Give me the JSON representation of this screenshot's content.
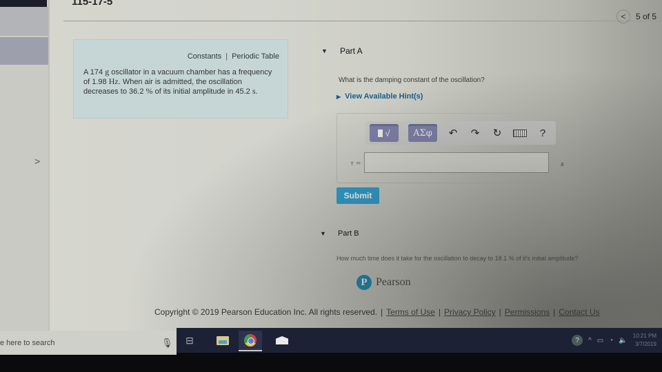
{
  "header": {
    "title": "115-17-5",
    "pager": {
      "prev_icon": "chevron-left-icon",
      "count": "5 of 5"
    }
  },
  "sidebar": {
    "expand_icon": "chevron-right-icon",
    "expand_glyph": ">"
  },
  "info_box": {
    "links": [
      "Constants",
      "Periodic Table"
    ],
    "separator": "|",
    "problem": {
      "p1": "A 174 ",
      "u1": "g",
      "p2": " oscillator in a vacuum chamber has a frequency of 1.98 ",
      "u2": "Hz",
      "p3": ". When air is admitted, the oscillation decreases to 36.2 ",
      "u3": "%",
      "p4": " of its initial amplitude in 45.2 ",
      "u4": "s",
      "p5": "."
    }
  },
  "part_a": {
    "label": "Part A",
    "question": "What is the damping constant of the oscillation?",
    "hints_label": "View Available Hint(s)",
    "toolbar": {
      "template_label": "√",
      "greek_label": "ΑΣφ",
      "undo_glyph": "↶",
      "redo_glyph": "↷",
      "reset_glyph": "↻",
      "help_glyph": "?"
    },
    "variable_label": "τ =",
    "answer_value": "",
    "unit": "s",
    "submit_label": "Submit"
  },
  "part_b": {
    "label": "Part B",
    "question": "How much time does it take for the oscillation to decay to 18.1 % of it's initial amplitude?"
  },
  "brand": {
    "logo_letter": "P",
    "name": "Pearson",
    "color": "#1a8fb8"
  },
  "footer": {
    "copyright": "Copyright © 2019 Pearson Education Inc. All rights reserved.",
    "links": [
      "Terms of Use",
      "Privacy Policy",
      "Permissions",
      "Contact Us"
    ],
    "separator": "|"
  },
  "taskbar": {
    "search_placeholder": "e here to search",
    "apps": [
      "task-view",
      "file-explorer",
      "chrome",
      "mail"
    ],
    "tray": {
      "help": "?",
      "chevron": "^",
      "time": "10:21 PM",
      "date": "3/7/2019"
    }
  },
  "colors": {
    "submit": "#2ea0d0",
    "link": "#1c5d8c",
    "toolbar_button": "#7e80a8"
  }
}
